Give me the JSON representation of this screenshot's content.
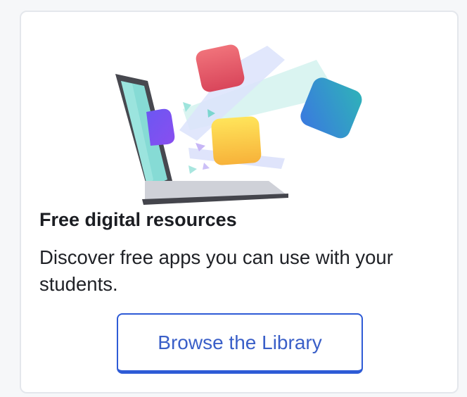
{
  "card": {
    "title": "Free digital resources",
    "description": "Discover free apps you can use with your students.",
    "button_label": "Browse the Library"
  },
  "colors": {
    "button_border": "#2e5bd6",
    "button_text": "#3a5fc8",
    "card_border": "#e4e7ec",
    "title_text": "#1b1d22"
  },
  "illustration": {
    "subject": "laptop-with-floating-app-tiles"
  }
}
